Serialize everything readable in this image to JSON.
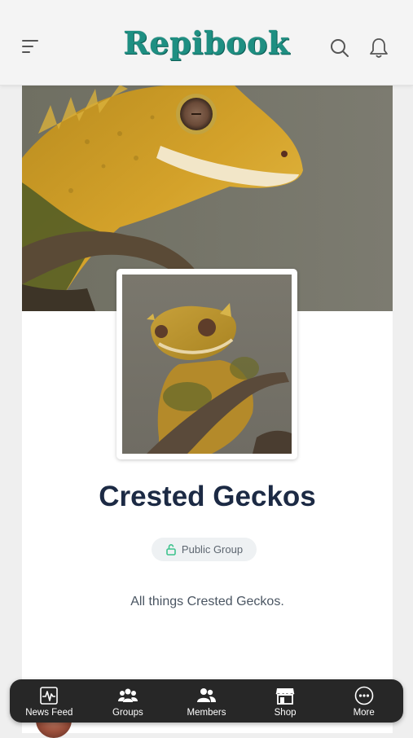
{
  "app": {
    "logo_text": "Repibook",
    "brand_color": "#1e8f82"
  },
  "header": {
    "menu_icon": "hamburger-menu-icon",
    "search_icon": "search-icon",
    "notifications_icon": "bell-icon"
  },
  "group": {
    "name": "Crested Geckos",
    "privacy_label": "Public Group",
    "privacy_icon": "lock-open-icon",
    "description": "All things Crested Geckos."
  },
  "bottom_nav": {
    "items": [
      {
        "label": "News Feed",
        "icon": "activity-icon"
      },
      {
        "label": "Groups",
        "icon": "groups-icon"
      },
      {
        "label": "Members",
        "icon": "members-icon"
      },
      {
        "label": "Shop",
        "icon": "shop-icon"
      },
      {
        "label": "More",
        "icon": "more-icon"
      }
    ]
  }
}
